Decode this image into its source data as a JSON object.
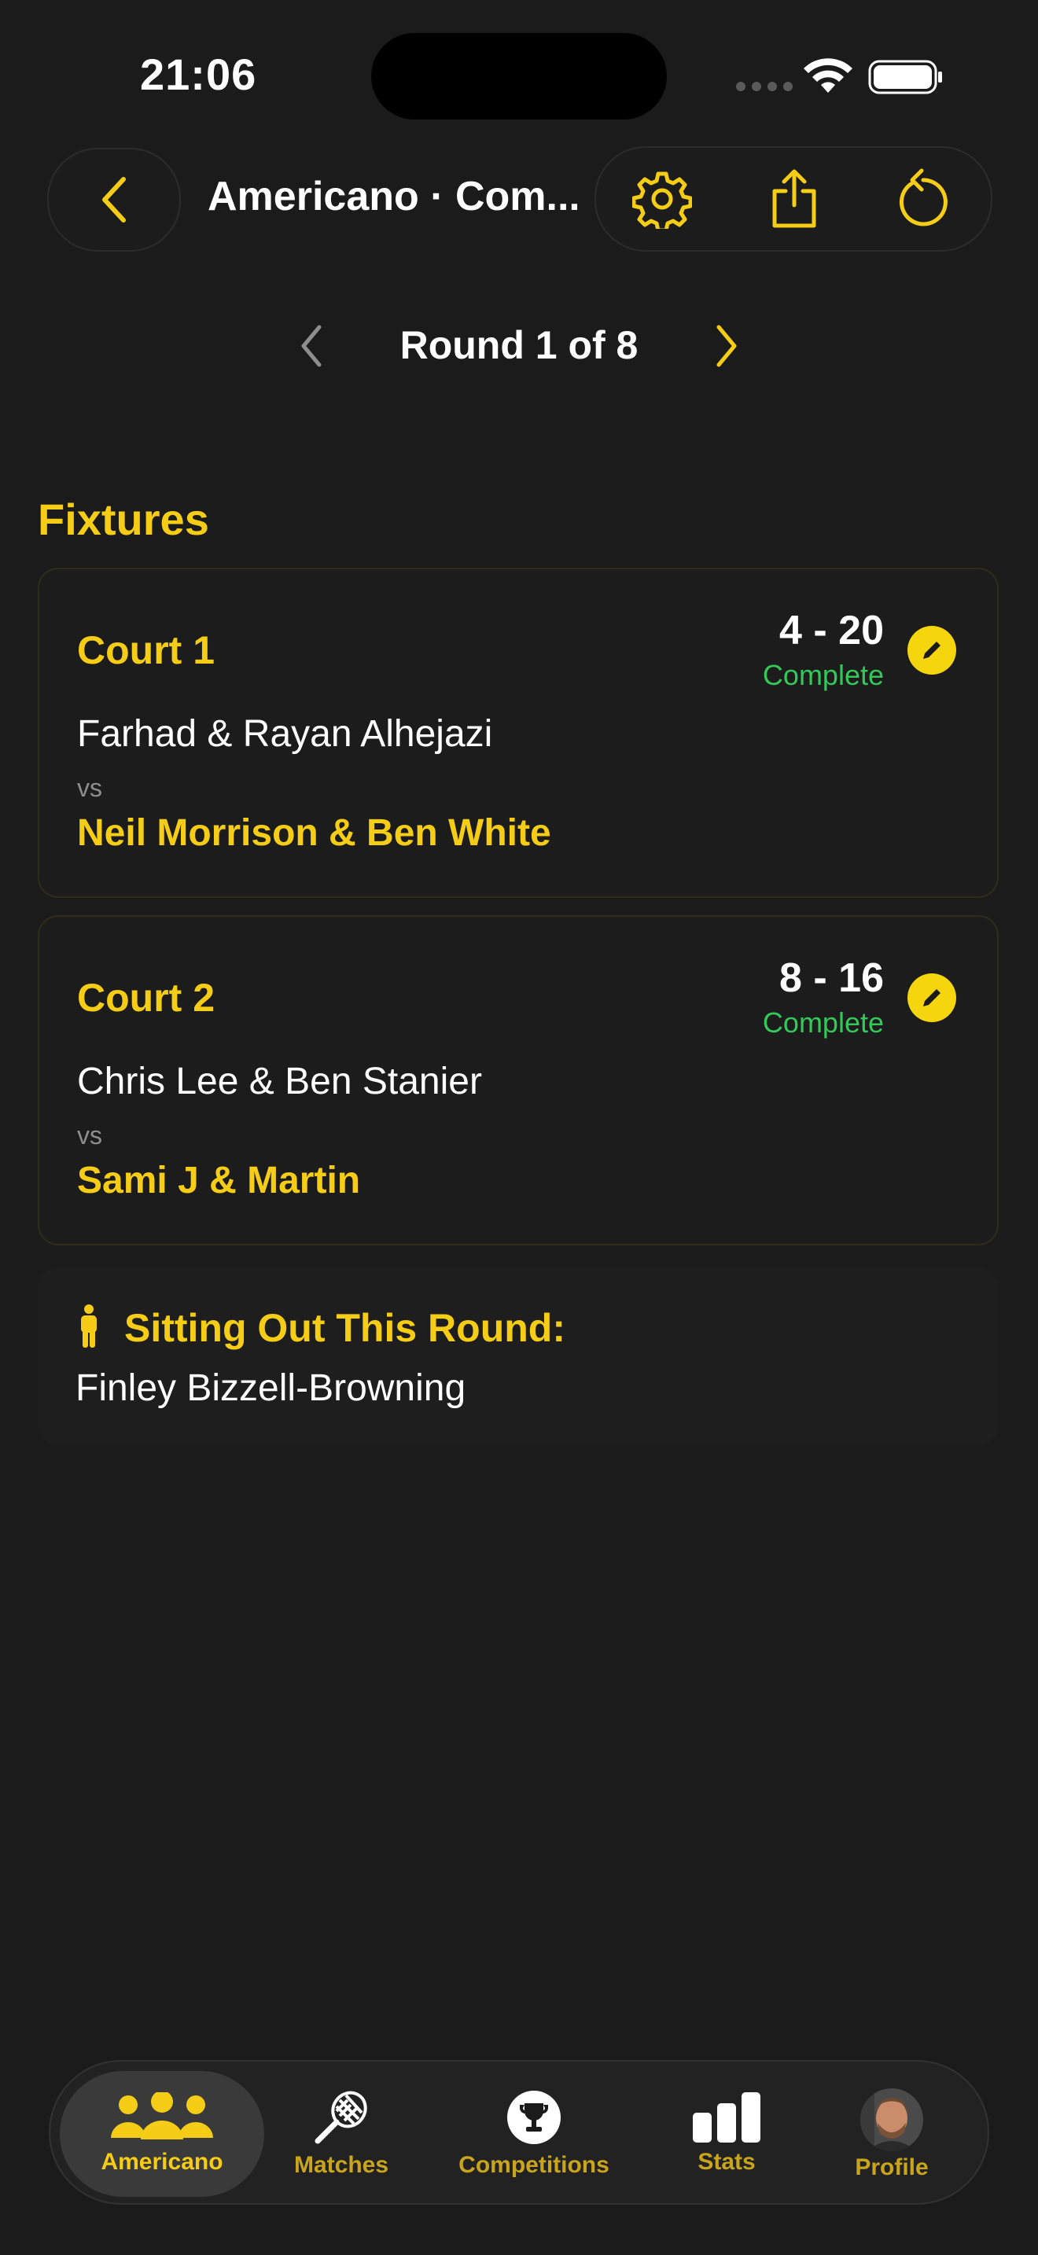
{
  "status_bar": {
    "time": "21:06"
  },
  "header": {
    "title": "Americano · Com..."
  },
  "round_nav": {
    "label": "Round 1 of 8"
  },
  "section": {
    "title": "Fixtures"
  },
  "fixtures": [
    {
      "court": "Court 1",
      "score": "4 - 20",
      "status": "Complete",
      "team1": "Farhad & Rayan Alhejazi",
      "vs": "vs",
      "team2": "Neil Morrison & Ben White"
    },
    {
      "court": "Court 2",
      "score": "8 - 16",
      "status": "Complete",
      "team1": "Chris Lee & Ben Stanier",
      "vs": "vs",
      "team2": "Sami J & Martin"
    }
  ],
  "sitting_out": {
    "title": "Sitting Out This Round:",
    "name": "Finley Bizzell-Browning"
  },
  "tabs": [
    {
      "label": "Americano",
      "icon": "people-icon"
    },
    {
      "label": "Matches",
      "icon": "racket-icon"
    },
    {
      "label": "Competitions",
      "icon": "trophy-icon"
    },
    {
      "label": "Stats",
      "icon": "bar-chart-icon"
    },
    {
      "label": "Profile",
      "icon": "avatar"
    }
  ],
  "colors": {
    "accent": "#f5cc16",
    "complete": "#34c759",
    "background": "#1b1b1b"
  }
}
